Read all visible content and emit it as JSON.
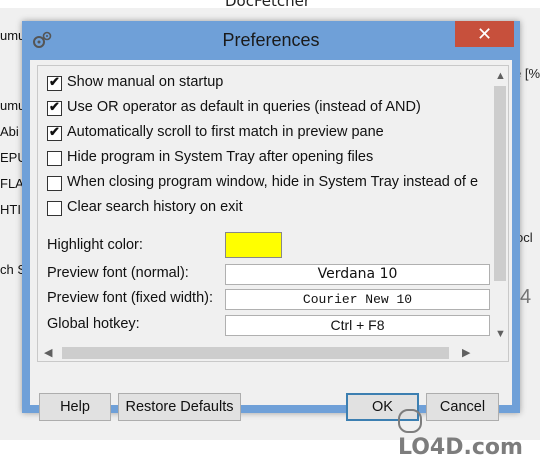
{
  "background": {
    "app_title": "DocFetcher",
    "left_cells": [
      "umu",
      "umu",
      "Abi",
      "EPU",
      "FLA",
      "HTI",
      "ch S"
    ],
    "right_cells": [
      "e [%",
      "ocl",
      "4"
    ]
  },
  "dialog": {
    "title": "Preferences",
    "close_glyph": "✕",
    "options": [
      {
        "label": "Show manual on startup",
        "checked": true
      },
      {
        "label": "Use OR operator as default in queries (instead of AND)",
        "checked": true
      },
      {
        "label": "Automatically scroll to first match in preview pane",
        "checked": true
      },
      {
        "label": "Hide program in System Tray after opening files",
        "checked": false
      },
      {
        "label": "When closing program window, hide in System Tray instead of e",
        "checked": false
      },
      {
        "label": "Clear search history on exit",
        "checked": false
      }
    ],
    "highlight_color_label": "Highlight color:",
    "highlight_color": "#ffff00",
    "preview_font_label": "Preview font (normal):",
    "preview_font_value": "Verdana 10",
    "preview_font_fixed_label": "Preview font (fixed width):",
    "preview_font_fixed_value": "Courier New 10",
    "global_hotkey_label": "Global hotkey:",
    "global_hotkey_value": "Ctrl + F8",
    "buttons": {
      "help": "Help",
      "restore_defaults": "Restore Defaults",
      "ok": "OK",
      "cancel": "Cancel"
    }
  },
  "watermark": "LO4D.com",
  "colors": {
    "titlebar": "#6fa0d8",
    "close": "#c7503c",
    "client": "#f0f0f0"
  }
}
